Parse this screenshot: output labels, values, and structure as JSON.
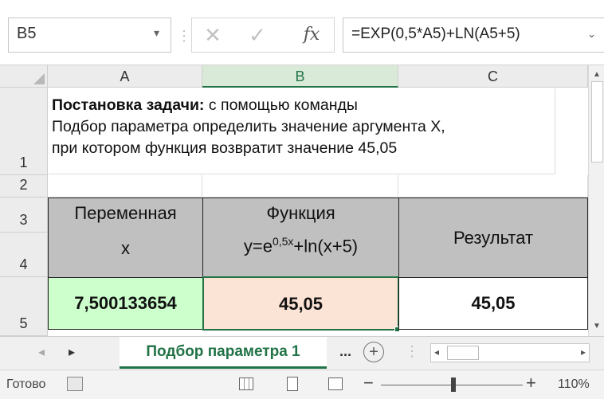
{
  "formula_bar": {
    "name_box": "B5",
    "name_box_dropdown": "▾",
    "separator": "⋮",
    "cancel_symbol": "✕",
    "enter_symbol": "✓",
    "fx_label": "fx",
    "formula": "=EXP(0,5*A5)+LN(A5+5)",
    "formula_dropdown": "⌄"
  },
  "columns": [
    "A",
    "B",
    "C"
  ],
  "selected_column": "B",
  "rows": [
    "1",
    "2",
    "3",
    "4",
    "5"
  ],
  "task": {
    "bold_prefix": "Постановка задачи:",
    "line1_rest": " с помощью команды",
    "line2": "Подбор параметра определить значение аргумента X,",
    "line3": "при котором функция возвратит значение 45,05"
  },
  "table": {
    "header_variable_line1": "Переменная",
    "header_variable_line2": "x",
    "header_function_line1": "Функция",
    "header_function_formula_prefix": "y=e",
    "header_function_formula_sup": "0,5x",
    "header_function_formula_suffix": "+ln(x+5)",
    "header_result": "Результат",
    "value_x": "7,500133654",
    "value_function": "45,05",
    "value_result": "45,05"
  },
  "sheet_tabs": {
    "nav_left": "◂",
    "nav_right": "▸",
    "active_tab": "Подбор параметра 1",
    "more": "...",
    "add": "+",
    "hscroll_left": "◂",
    "hscroll_right": "▸"
  },
  "status_bar": {
    "status_text": "Готово",
    "zoom_minus": "−",
    "zoom_plus": "+",
    "zoom": "110%"
  },
  "colors": {
    "accent": "#217346",
    "header_gray": "#c0c0c0",
    "x_cell_fill": "#ccffcc",
    "function_cell_fill": "#fbe3d6"
  }
}
